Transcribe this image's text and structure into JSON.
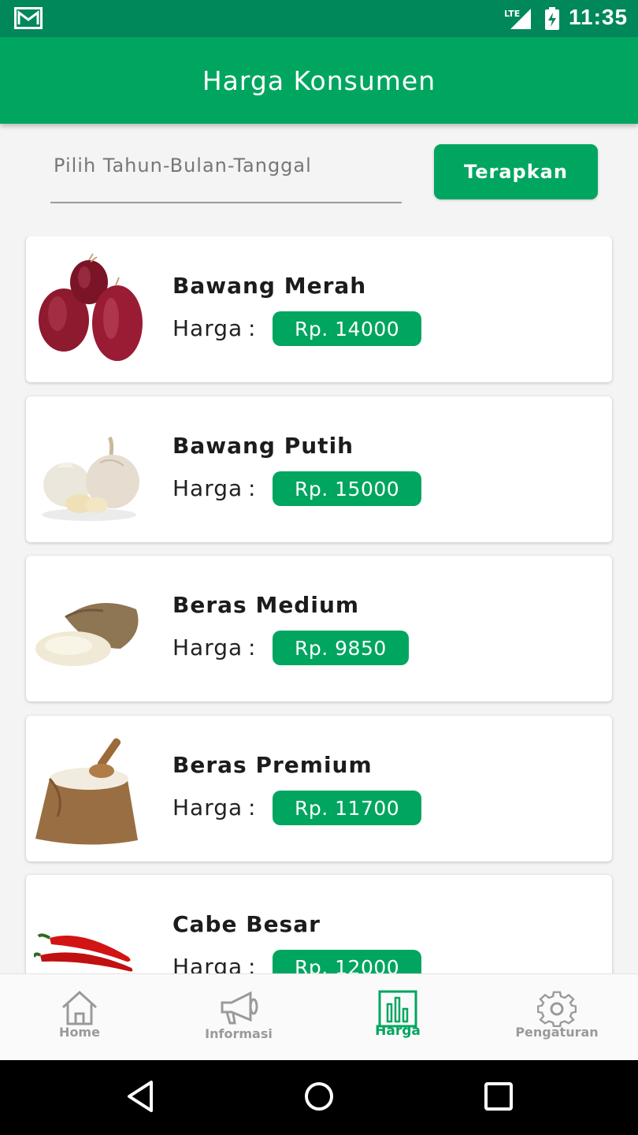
{
  "status_bar": {
    "time": "11:35",
    "network": "LTE",
    "icons": [
      "mail-icon",
      "signal-icon",
      "battery-icon"
    ]
  },
  "app_bar": {
    "title": "Harga Konsumen"
  },
  "filter": {
    "date_placeholder": "Pilih Tahun-Bulan-Tanggal",
    "apply_label": "Terapkan"
  },
  "products": [
    {
      "name": "Bawang Merah",
      "harga_label": "Harga",
      "separator": ":",
      "price": "Rp. 14000",
      "image": "red-onion-image"
    },
    {
      "name": "Bawang Putih",
      "harga_label": "Harga",
      "separator": ":",
      "price": "Rp. 15000",
      "image": "garlic-image"
    },
    {
      "name": "Beras Medium",
      "harga_label": "Harga",
      "separator": ":",
      "price": "Rp. 9850",
      "image": "rice-sack-image"
    },
    {
      "name": "Beras Premium",
      "harga_label": "Harga",
      "separator": ":",
      "price": "Rp. 11700",
      "image": "rice-sack-scoop-image"
    },
    {
      "name": "Cabe Besar",
      "harga_label": "Harga",
      "separator": ":",
      "price": "Rp. 12000",
      "image": "chili-image"
    }
  ],
  "bottom_nav": {
    "items": [
      {
        "label": "Home",
        "icon": "home-icon",
        "active": false
      },
      {
        "label": "Informasi",
        "icon": "megaphone-icon",
        "active": false
      },
      {
        "label": "Harga",
        "icon": "bar-chart-icon",
        "active": true
      },
      {
        "label": "Pengaturan",
        "icon": "gear-icon",
        "active": false
      }
    ]
  },
  "colors": {
    "primary": "#00a65f",
    "primary_dark": "#00875a",
    "inactive": "#9a9a9a"
  }
}
